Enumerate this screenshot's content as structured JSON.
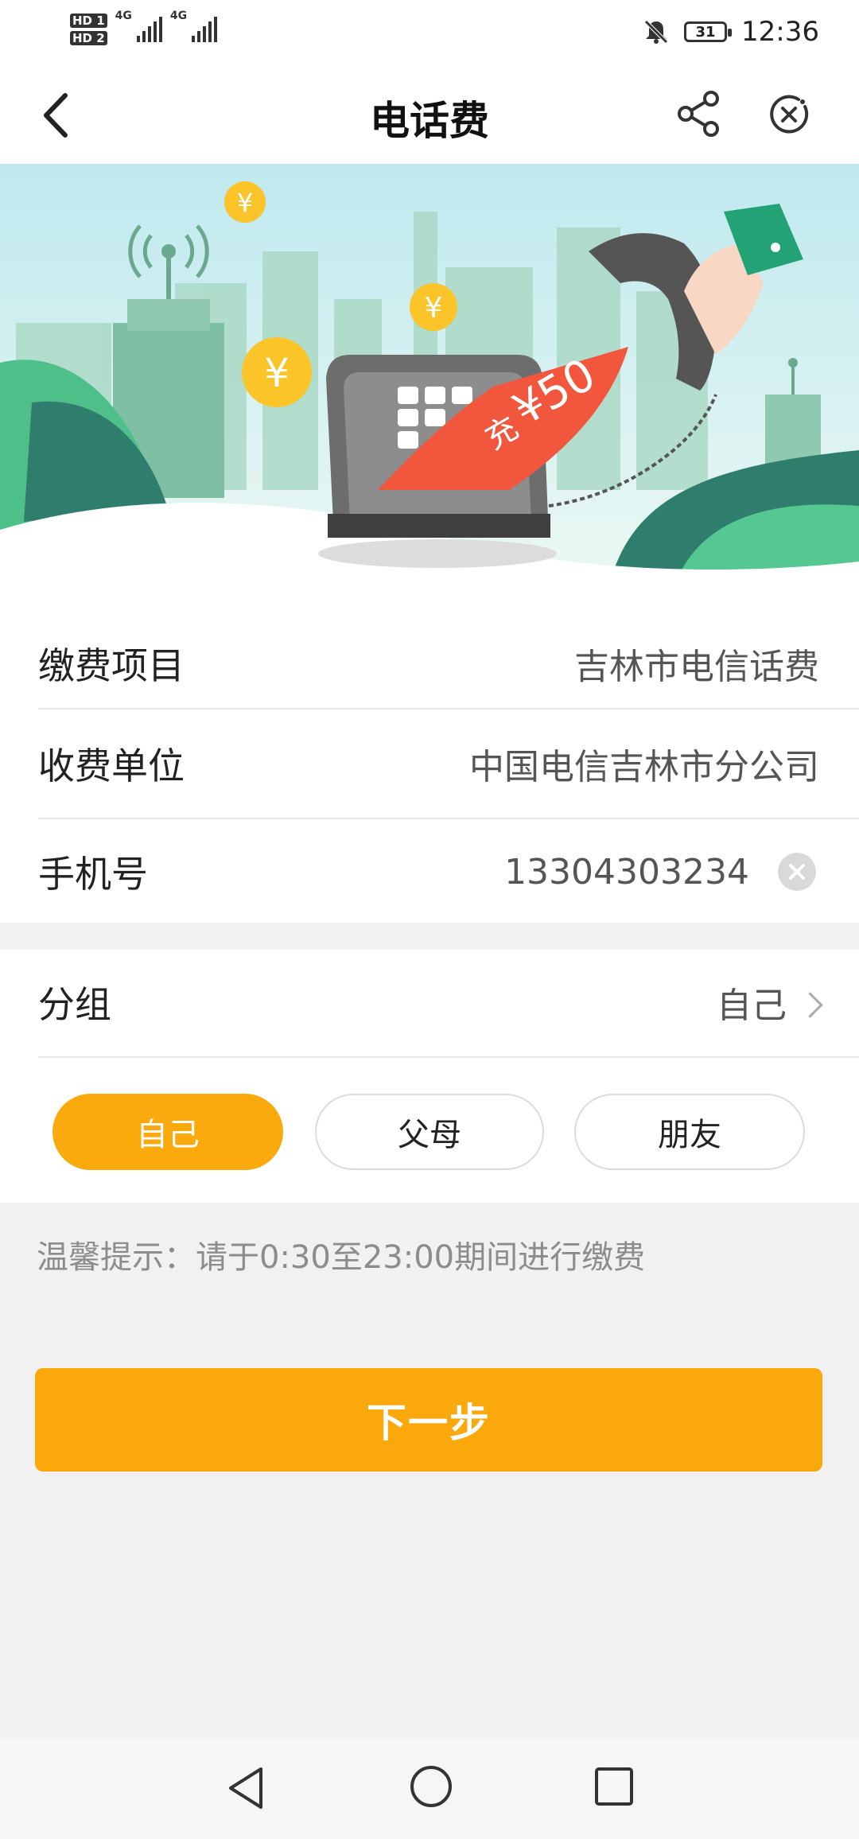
{
  "status_bar": {
    "time": "12:36",
    "battery": "31",
    "sim1": "HD 1",
    "sim2": "HD 2",
    "network1": "4G",
    "network2": "4G",
    "icons": [
      "hd-icon",
      "signal-icon",
      "mute-icon",
      "battery-icon"
    ]
  },
  "header": {
    "title": "电话费",
    "back_icon": "back-arrow-icon",
    "share_icon": "share-icon",
    "close_icon": "close-mini-program-icon"
  },
  "banner": {
    "stamp_text": "充",
    "amount": "¥50",
    "coin": "¥"
  },
  "form": {
    "item_label": "缴费项目",
    "item_value": "吉林市电信话费",
    "payee_label": "收费单位",
    "payee_value": "中国电信吉林市分公司",
    "phone_label": "手机号",
    "phone_value": "13304303234"
  },
  "group": {
    "label": "分组",
    "value": "自己",
    "options": [
      "自己",
      "父母",
      "朋友"
    ],
    "selected": "自己"
  },
  "tip": "温馨提示：请于0:30至23:00期间进行缴费",
  "next_button": "下一步",
  "colors": {
    "accent": "#fbaa0e",
    "background": "#f1f1f1",
    "banner_sky": "#d8f0ee",
    "banner_green": "#3fa37a"
  }
}
